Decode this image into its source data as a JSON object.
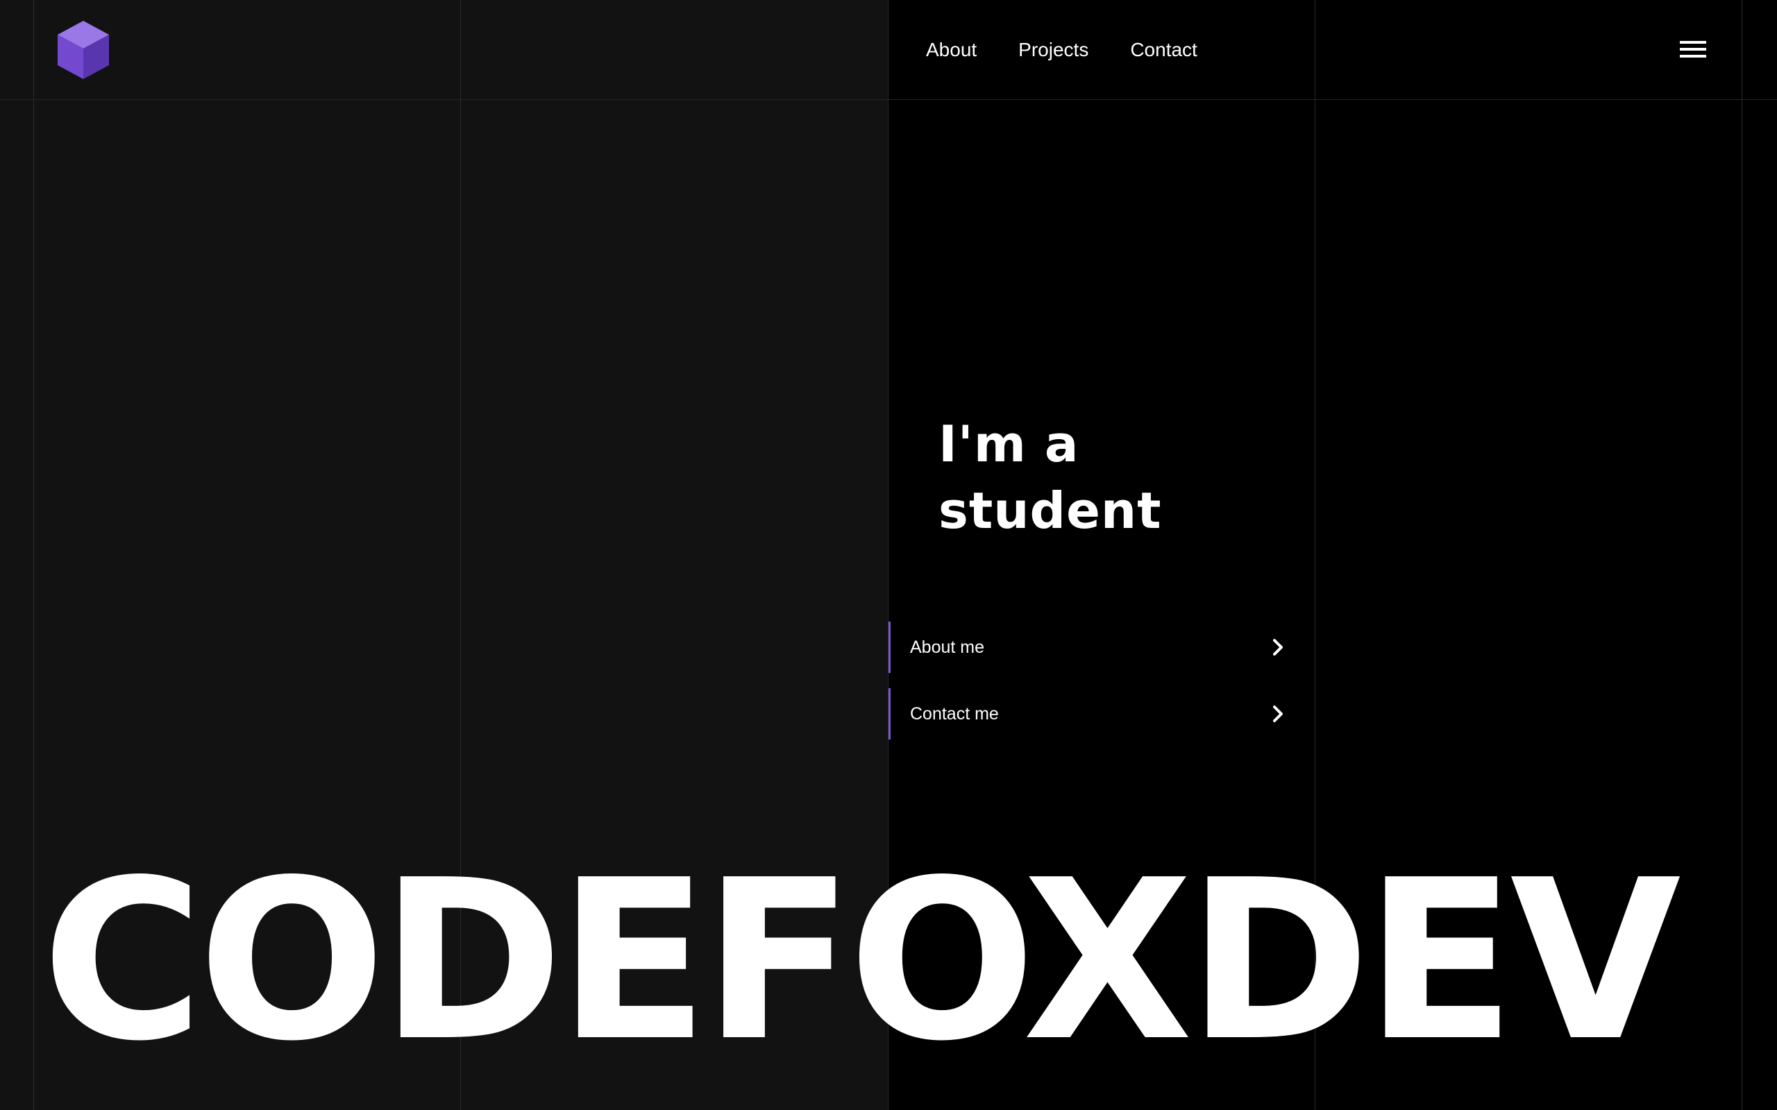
{
  "logo": {
    "icon": "cube-icon",
    "color": "#7b4fd1"
  },
  "nav": {
    "items": [
      {
        "label": "About"
      },
      {
        "label": "Projects"
      },
      {
        "label": "Contact"
      }
    ],
    "menu_icon": "hamburger-menu-icon"
  },
  "hero": {
    "line1": "I'm a",
    "line2": "student"
  },
  "cta": [
    {
      "label": "About me",
      "icon": "chevron-right-icon"
    },
    {
      "label": "Contact me",
      "icon": "chevron-right-icon"
    }
  ],
  "brand": {
    "wordmark": "CODEFOXDEV"
  },
  "colors": {
    "accent": "#7b5ad1",
    "background_left": "#121212",
    "background_right": "#000000",
    "text": "#ffffff"
  }
}
